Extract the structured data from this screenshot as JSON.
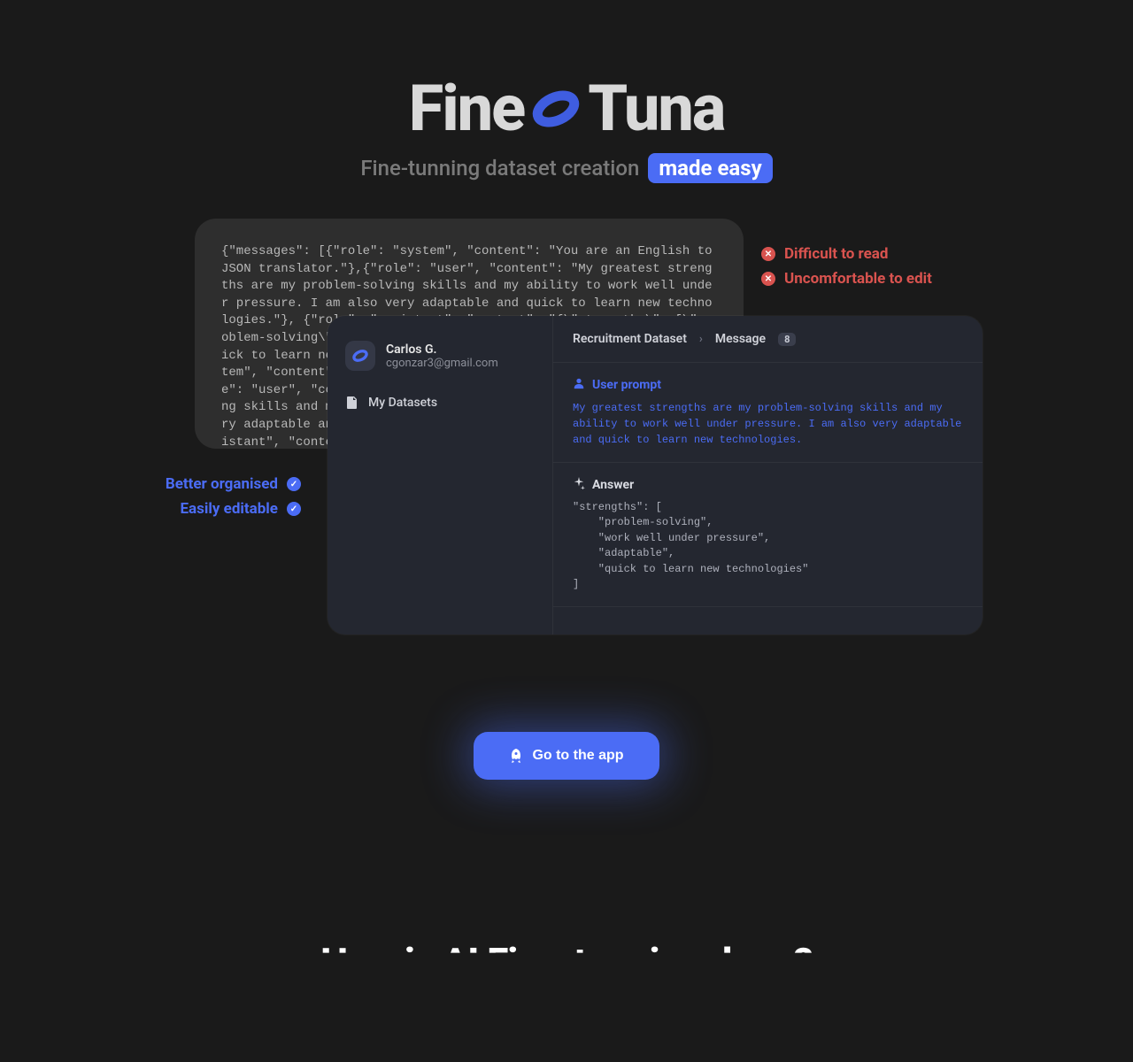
{
  "brand": {
    "word1": "Fine",
    "word2": "Tuna"
  },
  "tagline": {
    "prefix": "Fine-tunning dataset creation",
    "highlight": "made easy"
  },
  "json_card": {
    "text": "{\"messages\": [{\"role\": \"system\", \"content\": \"You are an English to JSON translator.\"},{\"role\": \"user\", \"content\": \"My greatest strengths are my problem-solving skills and my ability to work well under pressure. I am also very adaptable and quick to learn new technologies.\"}, {\"role\": \"assistant\", \"content\": \"{\\\"strengths\\\": [\\\"problem-solving\\\", \\\"work well under pressure\\\", \\\"adaptable\\\", \\\"quick to learn new technologies\\\"]}\"}]}\\n{\"messages\": [{\"role\": \"system\", \"content\": \"You are an English to JSON translator.\"},{\"role\": \"user\", \"content\": \"My greatest strengths are my problem-solving skills and my ability to work well under pressure. I am also very adaptable and quick to learn new technologies.\"}, {\"role\": \"assistant\", \"content\": \"{\\\"strengths\\\": [\\\"problem-solving\\\", \\\"work well under pressure\\\", \\\"adaptable\\\", \\\"quick to learn new technologies\\\"]}\"}]}"
  },
  "drawbacks": {
    "item1": "Difficult to read",
    "item2": "Uncomfortable to edit"
  },
  "benefits": {
    "item1": "Better organised",
    "item2": "Easily editable"
  },
  "app": {
    "user": {
      "name": "Carlos G.",
      "email": "cgonzar3@gmail.com"
    },
    "nav": {
      "datasets": "My Datasets"
    },
    "breadcrumb": {
      "dataset": "Recruitment Dataset",
      "message_label": "Message",
      "message_num": "8"
    },
    "prompt": {
      "title": "User prompt",
      "text": "My greatest strengths are my problem-solving skills and my ability to work well under pressure. I am also very adaptable and quick to learn new technologies."
    },
    "answer": {
      "title": "Answer",
      "text": "\"strengths\": [\n    \"problem-solving\",\n    \"work well under pressure\",\n    \"adaptable\",\n    \"quick to learn new technologies\"\n]"
    }
  },
  "cta": {
    "label": "Go to the app"
  },
  "lower_heading": "How is AI Fine-tunning done?"
}
